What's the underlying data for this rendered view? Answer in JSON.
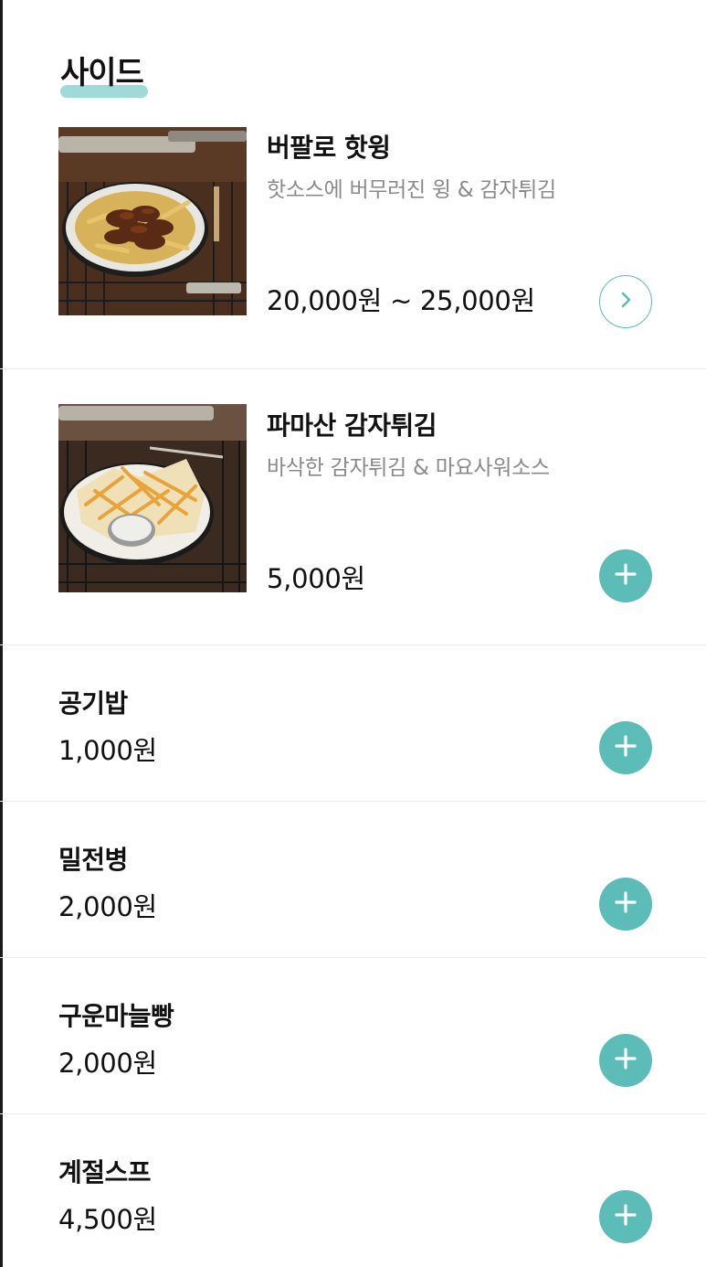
{
  "section": {
    "title": "사이드"
  },
  "featured_items": [
    {
      "name": "버팔로 핫윙",
      "description": "핫소스에 버무러진 윙 & 감자튀김",
      "price": "20,000원 ~ 25,000원",
      "action_icon": "chevron-right-icon"
    },
    {
      "name": "파마산 감자튀김",
      "description": "바삭한 감자튀김 & 마요사워소스",
      "price": "5,000원",
      "action_icon": "plus-icon"
    }
  ],
  "simple_items": [
    {
      "name": "공기밥",
      "price": "1,000원"
    },
    {
      "name": "밀전병",
      "price": "2,000원"
    },
    {
      "name": "구운마늘빵",
      "price": "2,000원"
    },
    {
      "name": "계절스프",
      "price": "4,500원"
    }
  ],
  "colors": {
    "accent": "#5bbcb8",
    "highlight": "#8fd3d1",
    "muted_text": "#8a8a8a",
    "divider": "#ececec"
  }
}
